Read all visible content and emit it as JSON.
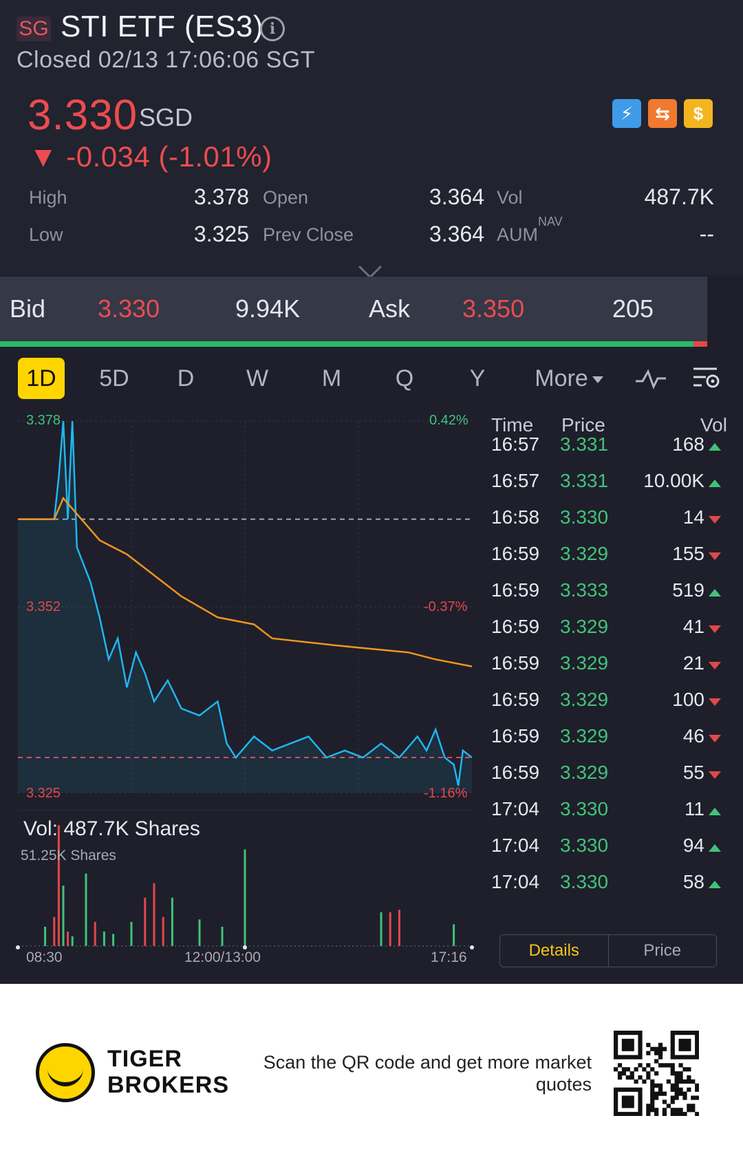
{
  "header": {
    "market_badge": "SG",
    "title": "STI ETF (ES3)",
    "status": "Closed 02/13 17:06:06 SGT",
    "price": "3.330",
    "currency": "SGD",
    "change": "▼ -0.034 (-1.01%)",
    "badges": [
      "lightning-badge-icon",
      "exchange-badge-icon",
      "dollar-badge-icon"
    ]
  },
  "stats": {
    "high_label": "High",
    "high": "3.378",
    "low_label": "Low",
    "low": "3.325",
    "open_label": "Open",
    "open": "3.364",
    "prev_close_label": "Prev Close",
    "prev_close": "3.364",
    "vol_label": "Vol",
    "vol": "487.7K",
    "aum_label": "AUM",
    "aum_sup": "NAV",
    "aum": "--"
  },
  "bidask": {
    "bid_label": "Bid",
    "bid_price": "3.330",
    "bid_size": "9.94K",
    "ask_label": "Ask",
    "ask_price": "3.350",
    "ask_size": "205"
  },
  "tabs": [
    "1D",
    "5D",
    "D",
    "W",
    "M",
    "Q",
    "Y",
    "More"
  ],
  "active_tab": "1D",
  "chart_labels": {
    "y_top": "3.378",
    "y_mid": "3.352",
    "y_bot": "3.325",
    "pct_top": "0.42%",
    "pct_mid": "-0.37%",
    "pct_bot": "-1.16%",
    "vol_title": "Vol:   487.7K Shares",
    "vol_scale": "51.25K Shares",
    "x_start": "08:30",
    "x_mid": "12:00/13:00",
    "x_end": "17:16"
  },
  "chart_data": {
    "type": "line",
    "series": [],
    "price_series_points": [
      [
        0,
        3.364
      ],
      [
        8,
        3.364
      ],
      [
        9,
        3.37
      ],
      [
        10,
        3.378
      ],
      [
        11,
        3.364
      ],
      [
        12,
        3.378
      ],
      [
        13,
        3.36
      ],
      [
        16,
        3.355
      ],
      [
        18,
        3.35
      ],
      [
        20,
        3.344
      ],
      [
        22,
        3.347
      ],
      [
        24,
        3.34
      ],
      [
        26,
        3.345
      ],
      [
        28,
        3.342
      ],
      [
        30,
        3.338
      ],
      [
        33,
        3.341
      ],
      [
        36,
        3.337
      ],
      [
        40,
        3.336
      ],
      [
        44,
        3.338
      ],
      [
        46,
        3.332
      ],
      [
        48,
        3.33
      ],
      [
        52,
        3.333
      ],
      [
        56,
        3.331
      ],
      [
        60,
        3.332
      ],
      [
        64,
        3.333
      ],
      [
        68,
        3.33
      ],
      [
        72,
        3.331
      ],
      [
        76,
        3.33
      ],
      [
        80,
        3.332
      ],
      [
        84,
        3.33
      ],
      [
        88,
        3.333
      ],
      [
        90,
        3.331
      ],
      [
        92,
        3.334
      ],
      [
        94,
        3.33
      ],
      [
        96,
        3.329
      ],
      [
        97,
        3.326
      ],
      [
        98,
        3.331
      ],
      [
        100,
        3.33
      ]
    ],
    "avg_price_points": [
      [
        0,
        3.364
      ],
      [
        8,
        3.364
      ],
      [
        10,
        3.367
      ],
      [
        14,
        3.364
      ],
      [
        18,
        3.361
      ],
      [
        24,
        3.359
      ],
      [
        30,
        3.356
      ],
      [
        36,
        3.353
      ],
      [
        44,
        3.35
      ],
      [
        52,
        3.349
      ],
      [
        56,
        3.347
      ],
      [
        70,
        3.346
      ],
      [
        86,
        3.345
      ],
      [
        92,
        3.344
      ],
      [
        100,
        3.343
      ]
    ],
    "prev_close": 3.364,
    "ylim": [
      3.325,
      3.378
    ],
    "volume_bars": [
      {
        "x": 6,
        "v": 8,
        "c": "g"
      },
      {
        "x": 8,
        "v": 12,
        "c": "r"
      },
      {
        "x": 9,
        "v": 50,
        "c": "r"
      },
      {
        "x": 10,
        "v": 25,
        "c": "g"
      },
      {
        "x": 11,
        "v": 6,
        "c": "r"
      },
      {
        "x": 12,
        "v": 4,
        "c": "g"
      },
      {
        "x": 15,
        "v": 30,
        "c": "g"
      },
      {
        "x": 17,
        "v": 10,
        "c": "r"
      },
      {
        "x": 19,
        "v": 6,
        "c": "g"
      },
      {
        "x": 21,
        "v": 5,
        "c": "g"
      },
      {
        "x": 25,
        "v": 10,
        "c": "g"
      },
      {
        "x": 28,
        "v": 20,
        "c": "r"
      },
      {
        "x": 30,
        "v": 26,
        "c": "r"
      },
      {
        "x": 32,
        "v": 12,
        "c": "r"
      },
      {
        "x": 34,
        "v": 20,
        "c": "g"
      },
      {
        "x": 40,
        "v": 11,
        "c": "g"
      },
      {
        "x": 45,
        "v": 8,
        "c": "g"
      },
      {
        "x": 50,
        "v": 40,
        "c": "g"
      },
      {
        "x": 80,
        "v": 14,
        "c": "g"
      },
      {
        "x": 82,
        "v": 14,
        "c": "r"
      },
      {
        "x": 84,
        "v": 15,
        "c": "r"
      },
      {
        "x": 96,
        "v": 9,
        "c": "g"
      }
    ]
  },
  "tick_table": {
    "headers": [
      "Time",
      "Price",
      "Vol"
    ],
    "rows": [
      {
        "time": "16:57",
        "price": "3.331",
        "vol": "168",
        "dir": "up"
      },
      {
        "time": "16:57",
        "price": "3.331",
        "vol": "10.00K",
        "dir": "up"
      },
      {
        "time": "16:58",
        "price": "3.330",
        "vol": "14",
        "dir": "down"
      },
      {
        "time": "16:59",
        "price": "3.329",
        "vol": "155",
        "dir": "down"
      },
      {
        "time": "16:59",
        "price": "3.333",
        "vol": "519",
        "dir": "up"
      },
      {
        "time": "16:59",
        "price": "3.329",
        "vol": "41",
        "dir": "down"
      },
      {
        "time": "16:59",
        "price": "3.329",
        "vol": "21",
        "dir": "down"
      },
      {
        "time": "16:59",
        "price": "3.329",
        "vol": "100",
        "dir": "down"
      },
      {
        "time": "16:59",
        "price": "3.329",
        "vol": "46",
        "dir": "down"
      },
      {
        "time": "16:59",
        "price": "3.329",
        "vol": "55",
        "dir": "down"
      },
      {
        "time": "17:04",
        "price": "3.330",
        "vol": "11",
        "dir": "up"
      },
      {
        "time": "17:04",
        "price": "3.330",
        "vol": "94",
        "dir": "up"
      },
      {
        "time": "17:04",
        "price": "3.330",
        "vol": "58",
        "dir": "up"
      }
    ]
  },
  "segmented": {
    "details": "Details",
    "price": "Price"
  },
  "footer": {
    "brand_line1": "TIGER",
    "brand_line2": "BROKERS",
    "scan_text": "Scan the QR code and get more market quotes"
  },
  "colors": {
    "up": "#41c27a",
    "down": "#e2484b",
    "accent": "#ffd500",
    "price_line": "#1fb6f0",
    "avg_line": "#f0951f"
  }
}
